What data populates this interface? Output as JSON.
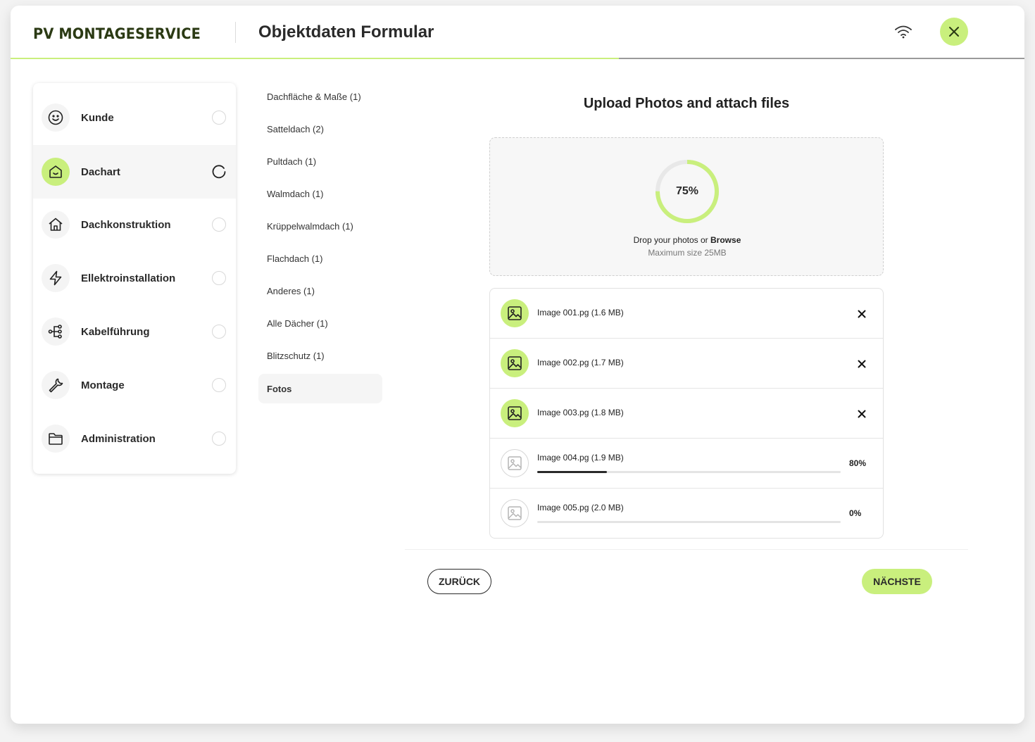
{
  "header": {
    "logo": "PV MONTAGESERVICE",
    "title": "Objektdaten Formular",
    "progress_fraction": 0.6
  },
  "sidebar": {
    "items": [
      {
        "label": "Kunde",
        "icon": "smiley-icon",
        "status": "pending"
      },
      {
        "label": "Dachart",
        "icon": "house-check-icon",
        "status": "in-progress"
      },
      {
        "label": "Dachkonstruktion",
        "icon": "home-icon",
        "status": "pending"
      },
      {
        "label": "Ellektroinstallation",
        "icon": "lightning-icon",
        "status": "pending"
      },
      {
        "label": "Kabelführung",
        "icon": "network-icon",
        "status": "pending"
      },
      {
        "label": "Montage",
        "icon": "wrench-icon",
        "status": "pending"
      },
      {
        "label": "Administration",
        "icon": "folder-icon",
        "status": "pending"
      }
    ]
  },
  "sublist": {
    "items": [
      "Dachfläche & Maße (1)",
      "Satteldach (2)",
      "Pultdach (1)",
      "Walmdach (1)",
      "Krüppelwalmdach (1)",
      "Flachdach (1)",
      "Anderes (1)",
      "Alle Dächer (1)",
      "Blitzschutz (1)",
      "Fotos"
    ],
    "active": "Fotos"
  },
  "upload": {
    "title": "Upload Photos and attach files",
    "progress_label": "75%",
    "progress_value": 0.75,
    "drop_text": "Drop your photos or ",
    "browse": "Browse",
    "max_size": "Maximum size 25MB"
  },
  "files": [
    {
      "name": "Image 001.pg (1.6 MB)",
      "state": "done"
    },
    {
      "name": "Image 002.pg (1.7 MB)",
      "state": "done"
    },
    {
      "name": "Image 003.pg (1.8 MB)",
      "state": "done"
    },
    {
      "name": "Image 004.pg (1.9 MB)",
      "state": "uploading",
      "percent_label": "80%",
      "progress": 0.23
    },
    {
      "name": "Image 005.pg (2.0 MB)",
      "state": "uploading",
      "percent_label": "0%",
      "progress": 0
    }
  ],
  "buttons": {
    "back": "ZURÜCK",
    "next": "NÄCHSTE"
  },
  "colors": {
    "accent": "#c9ef7d",
    "dark": "#2a2a2a"
  }
}
